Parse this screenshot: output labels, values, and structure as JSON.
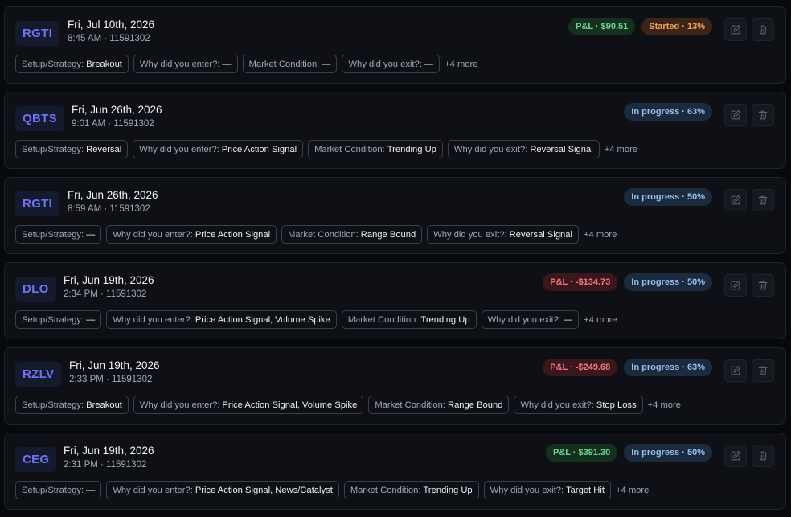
{
  "trades": [
    {
      "ticker": "RGTI",
      "date": "Fri, Jul 10th, 2026",
      "meta": "8:45 AM · 11591302",
      "badges": [
        {
          "text": "P&L · $90.51",
          "kind": "pnl-pos"
        },
        {
          "text": "Started · 13%",
          "kind": "started"
        }
      ],
      "tags": [
        {
          "key": "Setup/Strategy:",
          "value": "Breakout"
        },
        {
          "key": "Why did you enter?:",
          "value": "—"
        },
        {
          "key": "Market Condition:",
          "value": "—"
        },
        {
          "key": "Why did you exit?:",
          "value": "—"
        }
      ],
      "more": "+4 more"
    },
    {
      "ticker": "QBTS",
      "date": "Fri, Jun 26th, 2026",
      "meta": "9:01 AM · 11591302",
      "badges": [
        {
          "text": "In progress · 63%",
          "kind": "progress"
        }
      ],
      "tags": [
        {
          "key": "Setup/Strategy:",
          "value": "Reversal"
        },
        {
          "key": "Why did you enter?:",
          "value": "Price Action Signal"
        },
        {
          "key": "Market Condition:",
          "value": "Trending Up"
        },
        {
          "key": "Why did you exit?:",
          "value": "Reversal Signal"
        }
      ],
      "more": "+4 more"
    },
    {
      "ticker": "RGTI",
      "date": "Fri, Jun 26th, 2026",
      "meta": "8:59 AM · 11591302",
      "badges": [
        {
          "text": "In progress · 50%",
          "kind": "progress"
        }
      ],
      "tags": [
        {
          "key": "Setup/Strategy:",
          "value": "—"
        },
        {
          "key": "Why did you enter?:",
          "value": "Price Action Signal"
        },
        {
          "key": "Market Condition:",
          "value": "Range Bound"
        },
        {
          "key": "Why did you exit?:",
          "value": "Reversal Signal"
        }
      ],
      "more": "+4 more"
    },
    {
      "ticker": "DLO",
      "date": "Fri, Jun 19th, 2026",
      "meta": "2:34 PM · 11591302",
      "badges": [
        {
          "text": "P&L · -$134.73",
          "kind": "pnl-neg"
        },
        {
          "text": "In progress · 50%",
          "kind": "progress"
        }
      ],
      "tags": [
        {
          "key": "Setup/Strategy:",
          "value": "—"
        },
        {
          "key": "Why did you enter?:",
          "value": "Price Action Signal, Volume Spike"
        },
        {
          "key": "Market Condition:",
          "value": "Trending Up"
        },
        {
          "key": "Why did you exit?:",
          "value": "—"
        }
      ],
      "more": "+4 more"
    },
    {
      "ticker": "RZLV",
      "date": "Fri, Jun 19th, 2026",
      "meta": "2:33 PM · 11591302",
      "badges": [
        {
          "text": "P&L · -$249.68",
          "kind": "pnl-neg"
        },
        {
          "text": "In progress · 63%",
          "kind": "progress"
        }
      ],
      "tags": [
        {
          "key": "Setup/Strategy:",
          "value": "Breakout"
        },
        {
          "key": "Why did you enter?:",
          "value": "Price Action Signal, Volume Spike"
        },
        {
          "key": "Market Condition:",
          "value": "Range Bound"
        },
        {
          "key": "Why did you exit?:",
          "value": "Stop Loss"
        }
      ],
      "more": "+4 more"
    },
    {
      "ticker": "CEG",
      "date": "Fri, Jun 19th, 2026",
      "meta": "2:31 PM · 11591302",
      "badges": [
        {
          "text": "P&L · $391.30",
          "kind": "pnl-pos"
        },
        {
          "text": "In progress · 50%",
          "kind": "progress"
        }
      ],
      "tags": [
        {
          "key": "Setup/Strategy:",
          "value": "—"
        },
        {
          "key": "Why did you enter?:",
          "value": "Price Action Signal, News/Catalyst"
        },
        {
          "key": "Market Condition:",
          "value": "Trending Up"
        },
        {
          "key": "Why did you exit?:",
          "value": "Target Hit"
        }
      ],
      "more": "+4 more"
    }
  ],
  "icons": {
    "edit": "edit-icon",
    "delete": "trash-icon"
  },
  "colors": {
    "accent": "#6e73f2",
    "pnl_positive": "#6fd38f",
    "pnl_negative": "#f27a83",
    "started": "#f0a35f",
    "in_progress": "#93bff0"
  }
}
